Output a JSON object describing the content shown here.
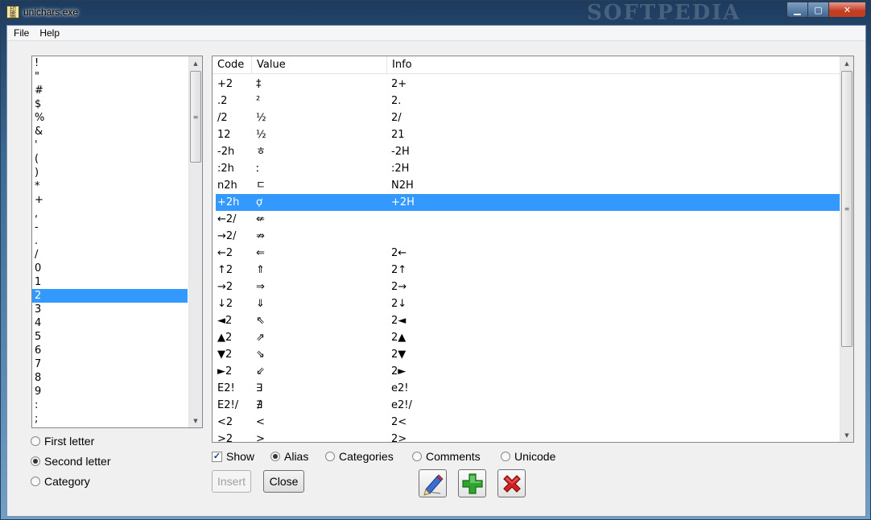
{
  "window": {
    "title": "unichars.exe",
    "watermark": "SOFTPEDIA",
    "app_icon_glyph": "印鑑",
    "caption": {
      "minimize": "▁",
      "maximize": "▢",
      "close": "✕"
    }
  },
  "menu": {
    "items": [
      "File",
      "Help"
    ]
  },
  "letter_list": {
    "items": [
      "!",
      "\"",
      "#",
      "$",
      "%",
      "&",
      "'",
      "(",
      ")",
      "*",
      "+",
      ",",
      "-",
      ".",
      "/",
      "0",
      "1",
      "2",
      "3",
      "4",
      "5",
      "6",
      "7",
      "8",
      "9",
      ":",
      ";"
    ],
    "selected_index": 17
  },
  "scroll_arrows": {
    "up": "▲",
    "down": "▼",
    "grip": "≡"
  },
  "table": {
    "columns": {
      "code": "Code",
      "value": "Value",
      "info": "Info"
    },
    "selected_index": 7,
    "rows": [
      {
        "code": "+2",
        "value": "‡",
        "info": "2+"
      },
      {
        "code": ".2",
        "value": "²",
        "info": "2."
      },
      {
        "code": "/2",
        "value": "½",
        "info": "2/"
      },
      {
        "code": "12",
        "value": "½",
        "info": "21"
      },
      {
        "code": "-2h",
        "value": "ㅎ",
        "info": "-2H"
      },
      {
        "code": ":2h",
        "value": "ː",
        "info": ":2H"
      },
      {
        "code": "n2h",
        "value": "ㄷ",
        "info": "N2H"
      },
      {
        "code": "+2h",
        "value": "ợ",
        "info": "+2H"
      },
      {
        "code": "←2/",
        "value": "⇍",
        "info": ""
      },
      {
        "code": "→2/",
        "value": "⇏",
        "info": ""
      },
      {
        "code": "←2",
        "value": "⇐",
        "info": "2←"
      },
      {
        "code": "↑2",
        "value": "⇑",
        "info": "2↑"
      },
      {
        "code": "→2",
        "value": "⇒",
        "info": "2→"
      },
      {
        "code": "↓2",
        "value": "⇓",
        "info": "2↓"
      },
      {
        "code": "◄2",
        "value": "⇖",
        "info": "2◄"
      },
      {
        "code": "▲2",
        "value": "⇗",
        "info": "2▲"
      },
      {
        "code": "▼2",
        "value": "⇘",
        "info": "2▼"
      },
      {
        "code": "►2",
        "value": "⇙",
        "info": "2►"
      },
      {
        "code": "E2!",
        "value": "∃",
        "info": "e2!"
      },
      {
        "code": "E2!/",
        "value": "∄",
        "info": "e2!/"
      },
      {
        "code": "<2",
        "value": "<",
        "info": "2<"
      },
      {
        "code": ">2",
        "value": ">",
        "info": "2>"
      }
    ]
  },
  "sort_options": {
    "first_letter": "First letter",
    "second_letter": "Second letter",
    "category": "Category",
    "selected": "second_letter"
  },
  "show_options": {
    "show_label": "Show",
    "show_checked": true,
    "checkmark": "✓",
    "alias": "Alias",
    "categories": "Categories",
    "comments": "Comments",
    "unicode": "Unicode",
    "selected": "alias"
  },
  "buttons": {
    "insert": "Insert",
    "close": "Close"
  },
  "icons": {
    "edit": "pencil-icon",
    "add": "plus-icon",
    "delete": "x-icon"
  },
  "colors": {
    "selection": "#3399ff",
    "add_green": "#2fa52f",
    "delete_red": "#d42020"
  }
}
